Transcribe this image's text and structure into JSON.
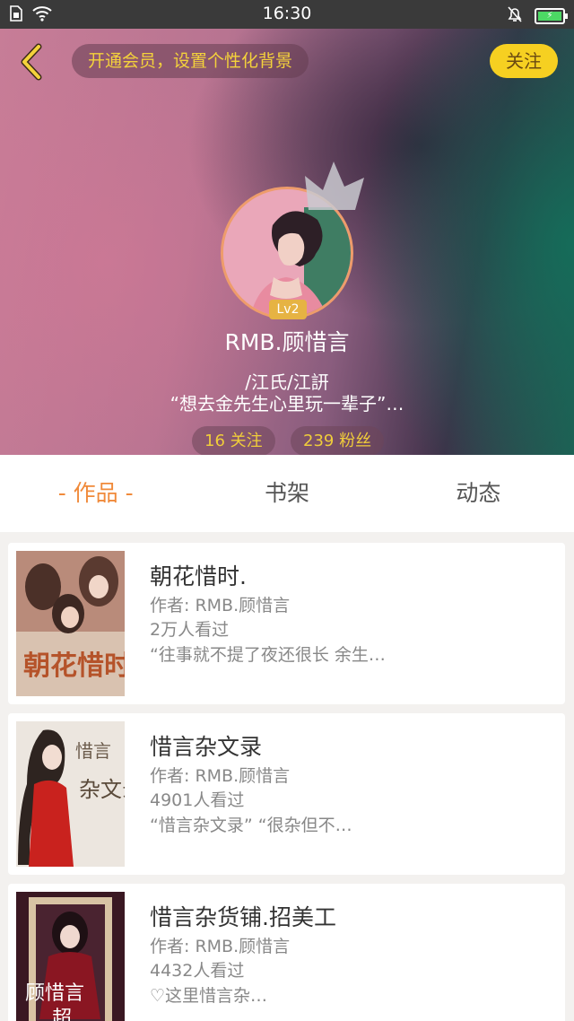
{
  "status_bar": {
    "time": "16:30",
    "icons": [
      "sim-icon",
      "wifi-icon",
      "mute-bell-icon",
      "battery-charging-icon"
    ]
  },
  "header": {
    "vip_prompt": "开通会员，设置个性化背景",
    "follow_label": "关注",
    "level": "Lv2",
    "username": "RMB.顾惜言",
    "bio_line1": "/江氏/江訮",
    "bio_line2": "“想去金先生心里玩一辈子”…",
    "following": "16 关注",
    "fans": "239 粉丝"
  },
  "tabs": {
    "works": "- 作品 -",
    "bookshelf": "书架",
    "activity": "动态"
  },
  "books": [
    {
      "title": "朝花惜时.",
      "author": "作者: RMB.顾惜言",
      "views": "2万人看过",
      "desc": "“往事就不提了夜还很长 余生…",
      "cover_text": "朝花惜时"
    },
    {
      "title": "惜言杂文录",
      "author": "作者: RMB.顾惜言",
      "views": "4901人看过",
      "desc": "“惜言杂文录” “很杂但不…",
      "cover_text": "杂文录"
    },
    {
      "title": "惜言杂货铺.招美工",
      "author": "作者: RMB.顾惜言",
      "views": "4432人看过",
      "desc": "♡这里惜言杂…",
      "cover_text": "顾惜言"
    }
  ],
  "colors": {
    "accent_orange": "#f08a3a",
    "follow_yellow": "#f6d021",
    "vip_text": "#f4d23b"
  }
}
